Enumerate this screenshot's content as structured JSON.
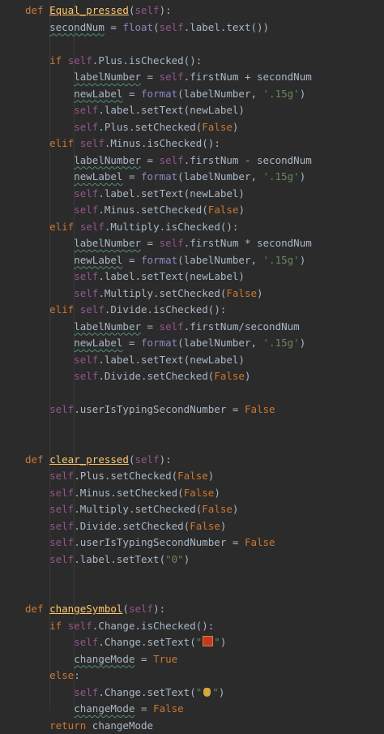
{
  "editor": {
    "language": "python",
    "theme": "darcula",
    "lines": [
      [
        [
          "def",
          "kw"
        ],
        [
          " ",
          ""
        ],
        [
          "Equal_pressed",
          "fnu"
        ],
        [
          "(",
          ""
        ],
        [
          "self",
          "slf"
        ],
        [
          "):",
          ""
        ]
      ],
      [
        [
          "    ",
          ""
        ],
        [
          "secondNum",
          "sq"
        ],
        [
          " = ",
          ""
        ],
        [
          "float",
          "bi"
        ],
        [
          "(",
          ""
        ],
        [
          "self",
          "slf"
        ],
        [
          ".label.text())",
          ""
        ]
      ],
      [],
      [
        [
          "    ",
          ""
        ],
        [
          "if ",
          "kw"
        ],
        [
          "self",
          "slf"
        ],
        [
          ".Plus.isChecked():",
          ""
        ]
      ],
      [
        [
          "        ",
          ""
        ],
        [
          "labelNumber",
          "sq"
        ],
        [
          " = ",
          ""
        ],
        [
          "self",
          "slf"
        ],
        [
          ".firstNum + secondNum",
          ""
        ]
      ],
      [
        [
          "        ",
          ""
        ],
        [
          "newLabel",
          "sq"
        ],
        [
          " = ",
          ""
        ],
        [
          "format",
          "bi"
        ],
        [
          "(labelNumber, ",
          ""
        ],
        [
          "'.15g'",
          "str"
        ],
        [
          ")",
          ""
        ]
      ],
      [
        [
          "        ",
          ""
        ],
        [
          "self",
          "slf"
        ],
        [
          ".label.setText(newLabel)",
          ""
        ]
      ],
      [
        [
          "        ",
          ""
        ],
        [
          "self",
          "slf"
        ],
        [
          ".Plus.setChecked(",
          ""
        ],
        [
          "False",
          "kw"
        ],
        [
          ")",
          ""
        ]
      ],
      [
        [
          "    ",
          ""
        ],
        [
          "elif ",
          "kw"
        ],
        [
          "self",
          "slf"
        ],
        [
          ".Minus.isChecked():",
          ""
        ]
      ],
      [
        [
          "        ",
          ""
        ],
        [
          "labelNumber",
          "sq"
        ],
        [
          " = ",
          ""
        ],
        [
          "self",
          "slf"
        ],
        [
          ".firstNum - secondNum",
          ""
        ]
      ],
      [
        [
          "        ",
          ""
        ],
        [
          "newLabel",
          "sq"
        ],
        [
          " = ",
          ""
        ],
        [
          "format",
          "bi"
        ],
        [
          "(labelNumber, ",
          ""
        ],
        [
          "'.15g'",
          "str"
        ],
        [
          ")",
          ""
        ]
      ],
      [
        [
          "        ",
          ""
        ],
        [
          "self",
          "slf"
        ],
        [
          ".label.setText(newLabel)",
          ""
        ]
      ],
      [
        [
          "        ",
          ""
        ],
        [
          "self",
          "slf"
        ],
        [
          ".Minus.setChecked(",
          ""
        ],
        [
          "False",
          "kw"
        ],
        [
          ")",
          ""
        ]
      ],
      [
        [
          "    ",
          ""
        ],
        [
          "elif ",
          "kw"
        ],
        [
          "self",
          "slf"
        ],
        [
          ".Multiply.isChecked():",
          ""
        ]
      ],
      [
        [
          "        ",
          ""
        ],
        [
          "labelNumber",
          "sq"
        ],
        [
          " = ",
          ""
        ],
        [
          "self",
          "slf"
        ],
        [
          ".firstNum * secondNum",
          ""
        ]
      ],
      [
        [
          "        ",
          ""
        ],
        [
          "newLabel",
          "sq"
        ],
        [
          " = ",
          ""
        ],
        [
          "format",
          "bi"
        ],
        [
          "(labelNumber, ",
          ""
        ],
        [
          "'.15g'",
          "str"
        ],
        [
          ")",
          ""
        ]
      ],
      [
        [
          "        ",
          ""
        ],
        [
          "self",
          "slf"
        ],
        [
          ".label.setText(newLabel)",
          ""
        ]
      ],
      [
        [
          "        ",
          ""
        ],
        [
          "self",
          "slf"
        ],
        [
          ".Multiply.setChecked(",
          ""
        ],
        [
          "False",
          "kw"
        ],
        [
          ")",
          ""
        ]
      ],
      [
        [
          "    ",
          ""
        ],
        [
          "elif ",
          "kw"
        ],
        [
          "self",
          "slf"
        ],
        [
          ".Divide.isChecked():",
          ""
        ]
      ],
      [
        [
          "        ",
          ""
        ],
        [
          "labelNumber",
          "sq"
        ],
        [
          " = ",
          ""
        ],
        [
          "self",
          "slf"
        ],
        [
          ".firstNum/secondNum",
          ""
        ]
      ],
      [
        [
          "        ",
          ""
        ],
        [
          "newLabel",
          "sq"
        ],
        [
          " = ",
          ""
        ],
        [
          "format",
          "bi"
        ],
        [
          "(labelNumber, ",
          ""
        ],
        [
          "'.15g'",
          "str"
        ],
        [
          ")",
          ""
        ]
      ],
      [
        [
          "        ",
          ""
        ],
        [
          "self",
          "slf"
        ],
        [
          ".label.setText(newLabel)",
          ""
        ]
      ],
      [
        [
          "        ",
          ""
        ],
        [
          "self",
          "slf"
        ],
        [
          ".Divide.setChecked(",
          ""
        ],
        [
          "False",
          "kw"
        ],
        [
          ")",
          ""
        ]
      ],
      [],
      [
        [
          "    ",
          ""
        ],
        [
          "self",
          "slf"
        ],
        [
          ".userIsTypingSecondNumber = ",
          ""
        ],
        [
          "False",
          "kw"
        ]
      ],
      [],
      [],
      [
        [
          "def",
          "kw"
        ],
        [
          " ",
          ""
        ],
        [
          "clear_pressed",
          "fnu"
        ],
        [
          "(",
          ""
        ],
        [
          "self",
          "slf"
        ],
        [
          "):",
          ""
        ]
      ],
      [
        [
          "    ",
          ""
        ],
        [
          "self",
          "slf"
        ],
        [
          ".Plus.setChecked(",
          ""
        ],
        [
          "False",
          "kw"
        ],
        [
          ")",
          ""
        ]
      ],
      [
        [
          "    ",
          ""
        ],
        [
          "self",
          "slf"
        ],
        [
          ".Minus.setChecked(",
          ""
        ],
        [
          "False",
          "kw"
        ],
        [
          ")",
          ""
        ]
      ],
      [
        [
          "    ",
          ""
        ],
        [
          "self",
          "slf"
        ],
        [
          ".Multiply.setChecked(",
          ""
        ],
        [
          "False",
          "kw"
        ],
        [
          ")",
          ""
        ]
      ],
      [
        [
          "    ",
          ""
        ],
        [
          "self",
          "slf"
        ],
        [
          ".Divide.setChecked(",
          ""
        ],
        [
          "False",
          "kw"
        ],
        [
          ")",
          ""
        ]
      ],
      [
        [
          "    ",
          ""
        ],
        [
          "self",
          "slf"
        ],
        [
          ".userIsTypingSecondNumber = ",
          ""
        ],
        [
          "False",
          "kw"
        ]
      ],
      [
        [
          "    ",
          ""
        ],
        [
          "self",
          "slf"
        ],
        [
          ".label.setText(",
          ""
        ],
        [
          "\"0\"",
          "str"
        ],
        [
          ")",
          ""
        ]
      ],
      [],
      [],
      [
        [
          "def",
          "kw"
        ],
        [
          " ",
          ""
        ],
        [
          "changeSymbol",
          "fnu"
        ],
        [
          "(",
          ""
        ],
        [
          "self",
          "slf"
        ],
        [
          "):",
          ""
        ]
      ],
      [
        [
          "    ",
          ""
        ],
        [
          "if ",
          "kw"
        ],
        [
          "self",
          "slf"
        ],
        [
          ".Change.isChecked():",
          ""
        ]
      ],
      [
        [
          "        ",
          ""
        ],
        [
          "self",
          "slf"
        ],
        [
          ".Change.setText(",
          ""
        ],
        [
          "\"",
          "str"
        ],
        [
          "",
          "emoji1"
        ],
        [
          "\"",
          "str"
        ],
        [
          ")",
          ""
        ]
      ],
      [
        [
          "        ",
          ""
        ],
        [
          "changeMode",
          "sq"
        ],
        [
          " = ",
          ""
        ],
        [
          "True",
          "kw"
        ]
      ],
      [
        [
          "    ",
          ""
        ],
        [
          "else",
          "kw"
        ],
        [
          ":",
          ""
        ]
      ],
      [
        [
          "        ",
          ""
        ],
        [
          "self",
          "slf"
        ],
        [
          ".Change.setText(",
          ""
        ],
        [
          "\"",
          "str"
        ],
        [
          "",
          "emoji2"
        ],
        [
          "\"",
          "str"
        ],
        [
          ")",
          ""
        ]
      ],
      [
        [
          "        ",
          ""
        ],
        [
          "changeMode",
          "sq"
        ],
        [
          " = ",
          ""
        ],
        [
          "False",
          "kw"
        ]
      ],
      [
        [
          "    ",
          ""
        ],
        [
          "return ",
          "kw"
        ],
        [
          "changeMode",
          ""
        ]
      ]
    ]
  }
}
